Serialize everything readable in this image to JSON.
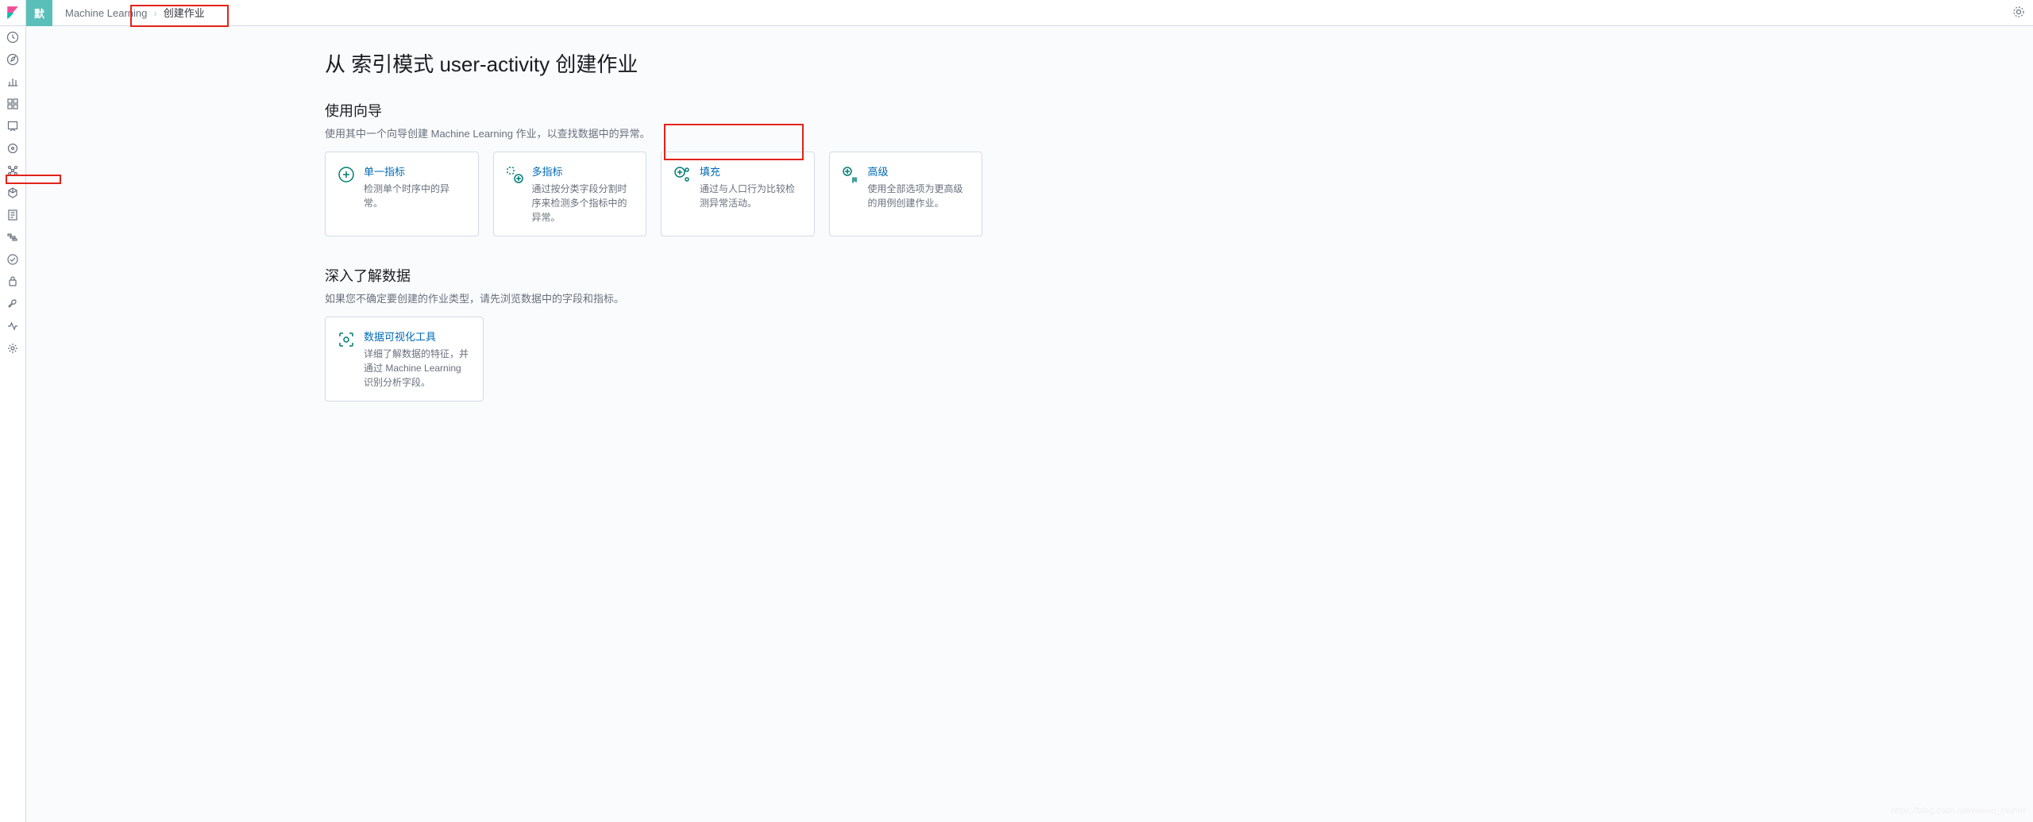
{
  "space_label": "默",
  "breadcrumbs": {
    "item1": "Machine Learning",
    "item2": "创建作业"
  },
  "page": {
    "title": "从 索引模式 user-activity 创建作业",
    "section1_title": "使用向导",
    "section1_sub": "使用其中一个向导创建 Machine Learning 作业，以查找数据中的异常。",
    "section2_title": "深入了解数据",
    "section2_sub": "如果您不确定要创建的作业类型，请先浏览数据中的字段和指标。"
  },
  "cards": {
    "single": {
      "title": "单一指标",
      "desc": "检测单个时序中的异常。"
    },
    "multi": {
      "title": "多指标",
      "desc": "通过按分类字段分割时序来检测多个指标中的异常。"
    },
    "pop": {
      "title": "填充",
      "desc": "通过与人口行为比较检测异常活动。"
    },
    "adv": {
      "title": "高级",
      "desc": "使用全部选项为更高级的用例创建作业。"
    },
    "dv": {
      "title": "数据可视化工具",
      "desc": "详细了解数据的特征，并通过 Machine Learning 识别分析字段。"
    }
  },
  "sidebar_icons": [
    "recent-icon",
    "discover-icon",
    "visualize-icon",
    "dashboard-icon",
    "canvas-icon",
    "maps-icon",
    "ml-icon",
    "infra-icon",
    "logs-icon",
    "apm-icon",
    "uptime-icon",
    "siem-icon",
    "devtools-icon",
    "monitoring-icon",
    "management-icon"
  ],
  "watermark": "https://blog.csdn.net/weixin_mumu"
}
